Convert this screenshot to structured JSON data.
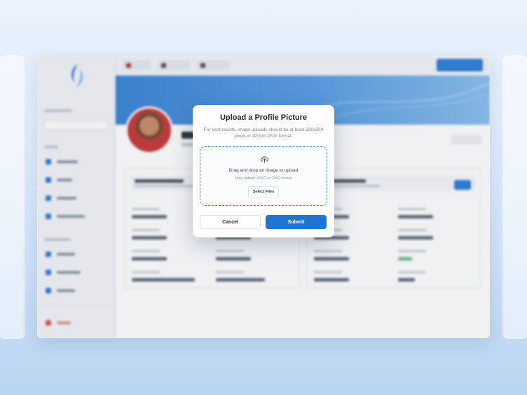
{
  "modal": {
    "title": "Upload a Profile Picture",
    "description": "For best results, image uploads should be at least 500x500 pixels in JPG or PNG format.",
    "dropzone": {
      "main_text": "Drag and drop an image to upload",
      "sub_text": "Only upload JPEG or PNG format",
      "select_label": "Select Files",
      "icon": "upload-cloud-icon"
    },
    "cancel_label": "Cancel",
    "submit_label": "Submit"
  },
  "colors": {
    "primary": "#1f74d6",
    "dropzone_border": "#3e88d8",
    "banner_start": "#3a86d6",
    "background_top": "#eaf2fb",
    "background_bottom": "#b9d4f1"
  }
}
